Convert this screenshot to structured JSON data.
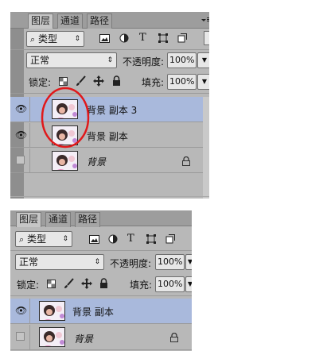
{
  "tabs": [
    "图层",
    "通道",
    "路径"
  ],
  "filter": {
    "icon": "search-icon",
    "label": "类型"
  },
  "blend_mode": "正常",
  "opacity": {
    "label": "不透明度:",
    "value": "100%"
  },
  "lock_label": "锁定:",
  "fill": {
    "label": "填充:",
    "value": "100%"
  },
  "panel_top": {
    "layers": [
      {
        "name": "背景 副本 3",
        "visible": true,
        "selected": true
      },
      {
        "name": "背景 副本",
        "visible": true,
        "selected": false
      },
      {
        "name": "背景",
        "visible": false,
        "selected": false,
        "locked": true,
        "italic": true
      }
    ],
    "annotation": {
      "shape": "ellipse",
      "color": "#e0191b"
    }
  },
  "panel_bottom": {
    "layers": [
      {
        "name": "背景 副本",
        "visible": true,
        "selected": true
      },
      {
        "name": "背景",
        "visible": false,
        "selected": false,
        "locked": true,
        "italic": true
      }
    ]
  },
  "colors": {
    "panel": "#b8b8b8",
    "selected_row": "#a9b9dc",
    "annotation": "#e0191b"
  }
}
